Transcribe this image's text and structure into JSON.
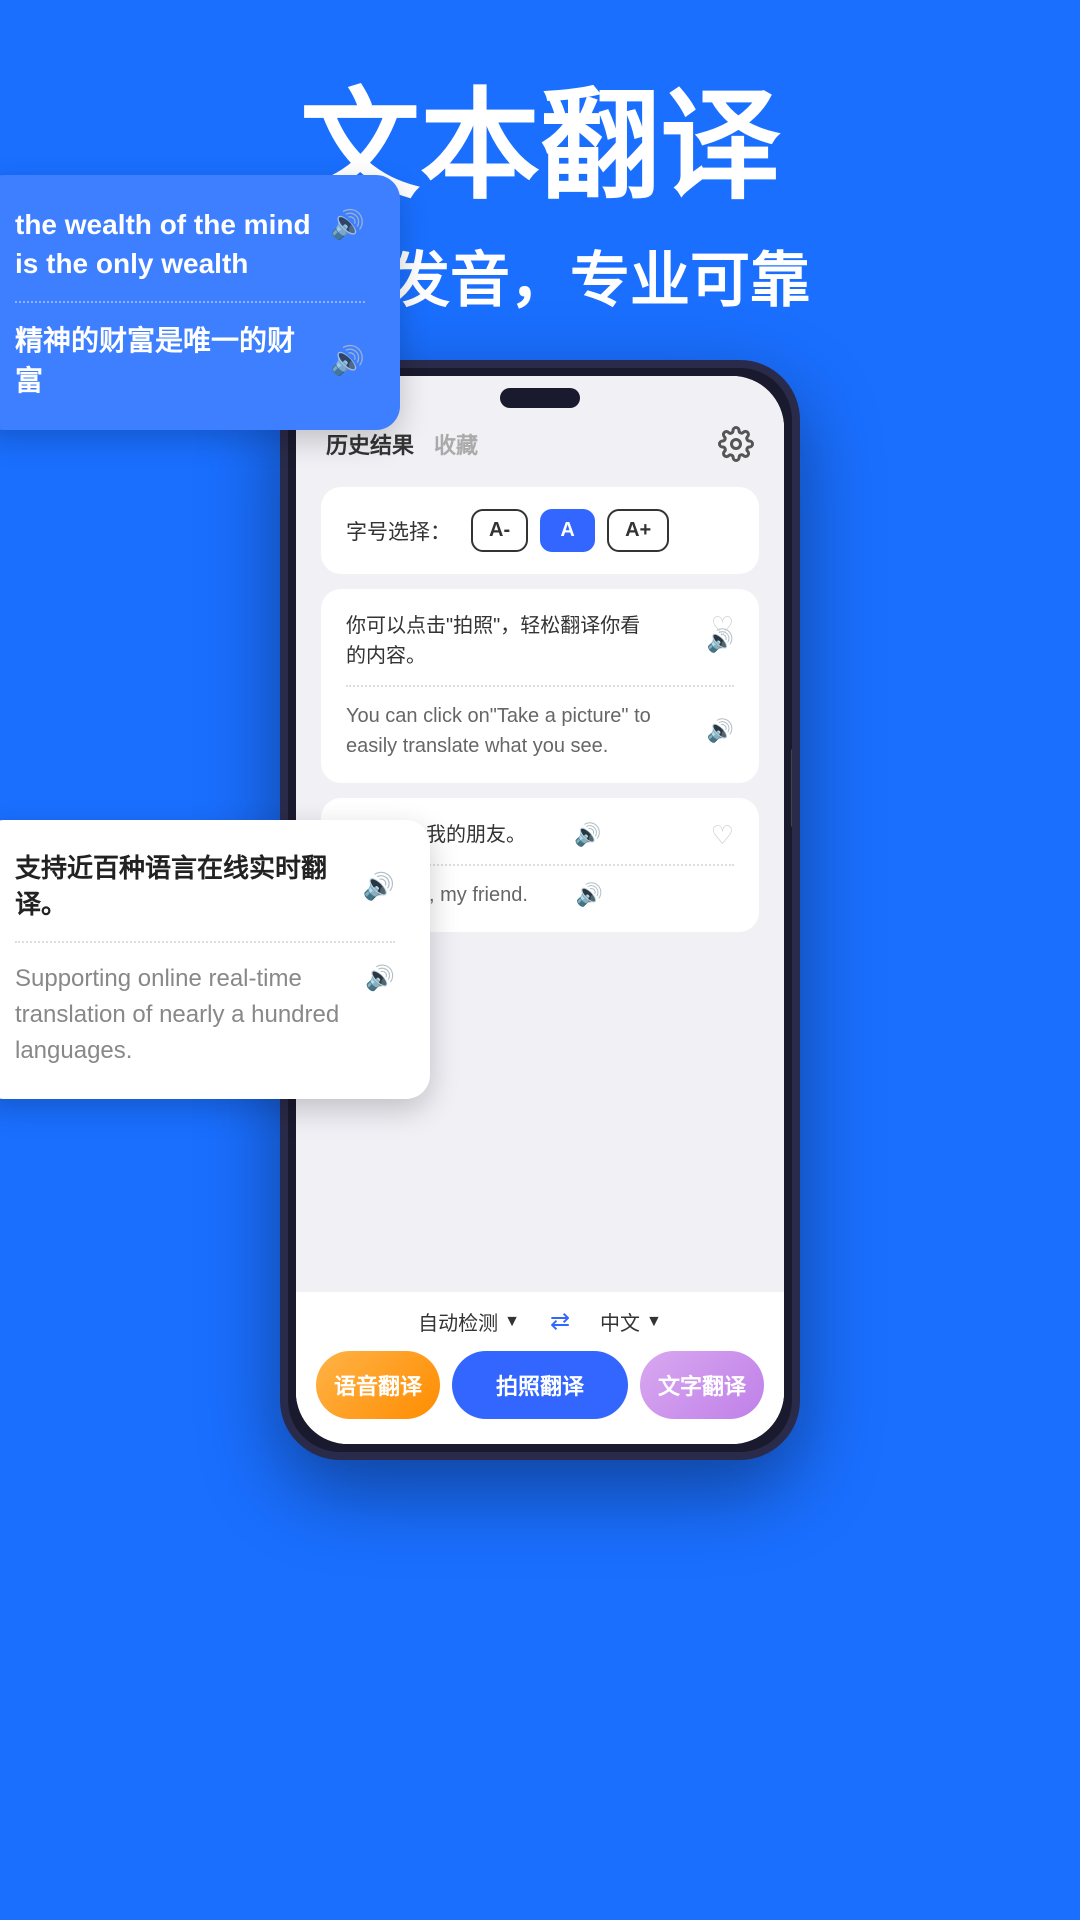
{
  "header": {
    "title": "文本翻译",
    "subtitle": "纯正发音，专业可靠"
  },
  "phone": {
    "header": {
      "tab1": "历史结果",
      "tab2": "收藏"
    },
    "font_size_card": {
      "label": "字号选择：",
      "btn_small": "A-",
      "btn_medium": "A",
      "btn_large": "A+"
    },
    "translation_items": [
      {
        "source": "你可以点击\"拍照\"，轻松翻译你看的内容。",
        "target": "You can click on\"Take a picture\" to easily translate what you see."
      },
      {
        "source": "欢迎你，我的朋友。",
        "target": "Welcome, my friend."
      }
    ],
    "bottom": {
      "lang_from": "自动检测",
      "lang_to": "中文",
      "btn_voice": "语音翻译",
      "btn_photo": "拍照翻译",
      "btn_text": "文字翻译"
    }
  },
  "floating_card_1": {
    "source": "the wealth of the mind is the only wealth",
    "target": "精神的财富是唯一的财富"
  },
  "floating_card_2": {
    "source": "支持近百种语言在线实时翻译。",
    "target": "Supporting online real-time translation of nearly a hundred languages."
  }
}
